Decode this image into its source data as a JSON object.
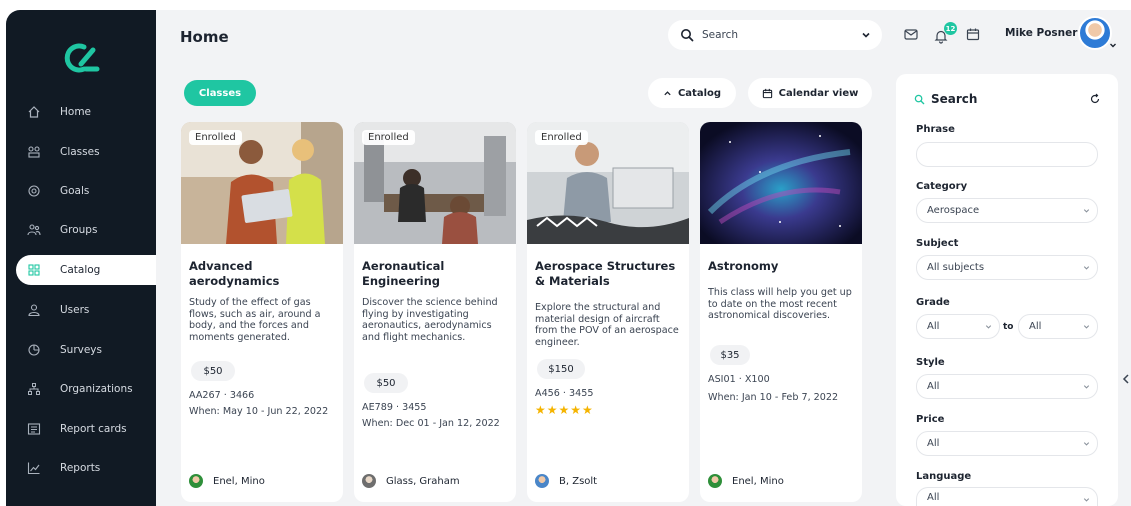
{
  "nav": {
    "items": [
      {
        "label": "Home",
        "icon": "home-icon"
      },
      {
        "label": "Classes",
        "icon": "classes-icon"
      },
      {
        "label": "Goals",
        "icon": "goals-icon"
      },
      {
        "label": "Groups",
        "icon": "groups-icon"
      },
      {
        "label": "Catalog",
        "icon": "catalog-icon",
        "active": true
      },
      {
        "label": "Users",
        "icon": "users-icon"
      },
      {
        "label": "Surveys",
        "icon": "surveys-icon"
      },
      {
        "label": "Organizations",
        "icon": "organizations-icon"
      },
      {
        "label": "Report cards",
        "icon": "report-cards-icon"
      },
      {
        "label": "Reports",
        "icon": "reports-icon"
      }
    ]
  },
  "header": {
    "title": "Home",
    "search_label": "Search",
    "notification_count": "12",
    "user_name": "Mike Posner"
  },
  "toolbar": {
    "classes_label": "Classes",
    "catalog_label": "Catalog",
    "calendar_label": "Calendar view"
  },
  "courses": [
    {
      "badge": "Enrolled",
      "title": "Advanced aerodynamics",
      "description": "Study of the effect of gas flows, such as air, around a body, and the forces and moments generated.",
      "price": "$50",
      "code": "AA267 · 3466",
      "when": "When: May 10 - Jun 22, 2022",
      "instructor": "Enel, Mino"
    },
    {
      "badge": "Enrolled",
      "title": "Aeronautical Engineering",
      "description": "Discover the science behind flying by investigating aeronautics, aerodynamics and flight mechanics.",
      "price": "$50",
      "code": "AE789 · 3455",
      "when": "When: Dec 01 - Jan 12, 2022",
      "instructor": "Glass, Graham"
    },
    {
      "badge": "Enrolled",
      "title": "Aerospace Structures & Materials",
      "description": "Explore the structural and material design of aircraft from the POV of an aerospace engineer.",
      "price": "$150",
      "code": "A456 · 3455",
      "stars": "★★★★★",
      "rating": 5,
      "instructor": "B, Zsolt"
    },
    {
      "title": "Astronomy",
      "description": "This class will help you get up to date on the most recent astronomical discoveries.",
      "price": "$35",
      "code": "ASI01 · X100",
      "when": "When: Jan 10 - Feb 7, 2022",
      "instructor": "Enel, Mino"
    }
  ],
  "filters": {
    "title": "Search",
    "phrase_label": "Phrase",
    "phrase_value": "",
    "category_label": "Category",
    "category_value": "Aerospace",
    "subject_label": "Subject",
    "subject_value": "All subjects",
    "grade_label": "Grade",
    "grade_from": "All",
    "grade_to_label": "to",
    "grade_to": "All",
    "style_label": "Style",
    "style_value": "All",
    "price_label": "Price",
    "price_value": "All",
    "language_label": "Language",
    "language_value": "All"
  },
  "colors": {
    "accent": "#1fc6a2",
    "sidebar": "#111a24",
    "star": "#f5b400"
  }
}
